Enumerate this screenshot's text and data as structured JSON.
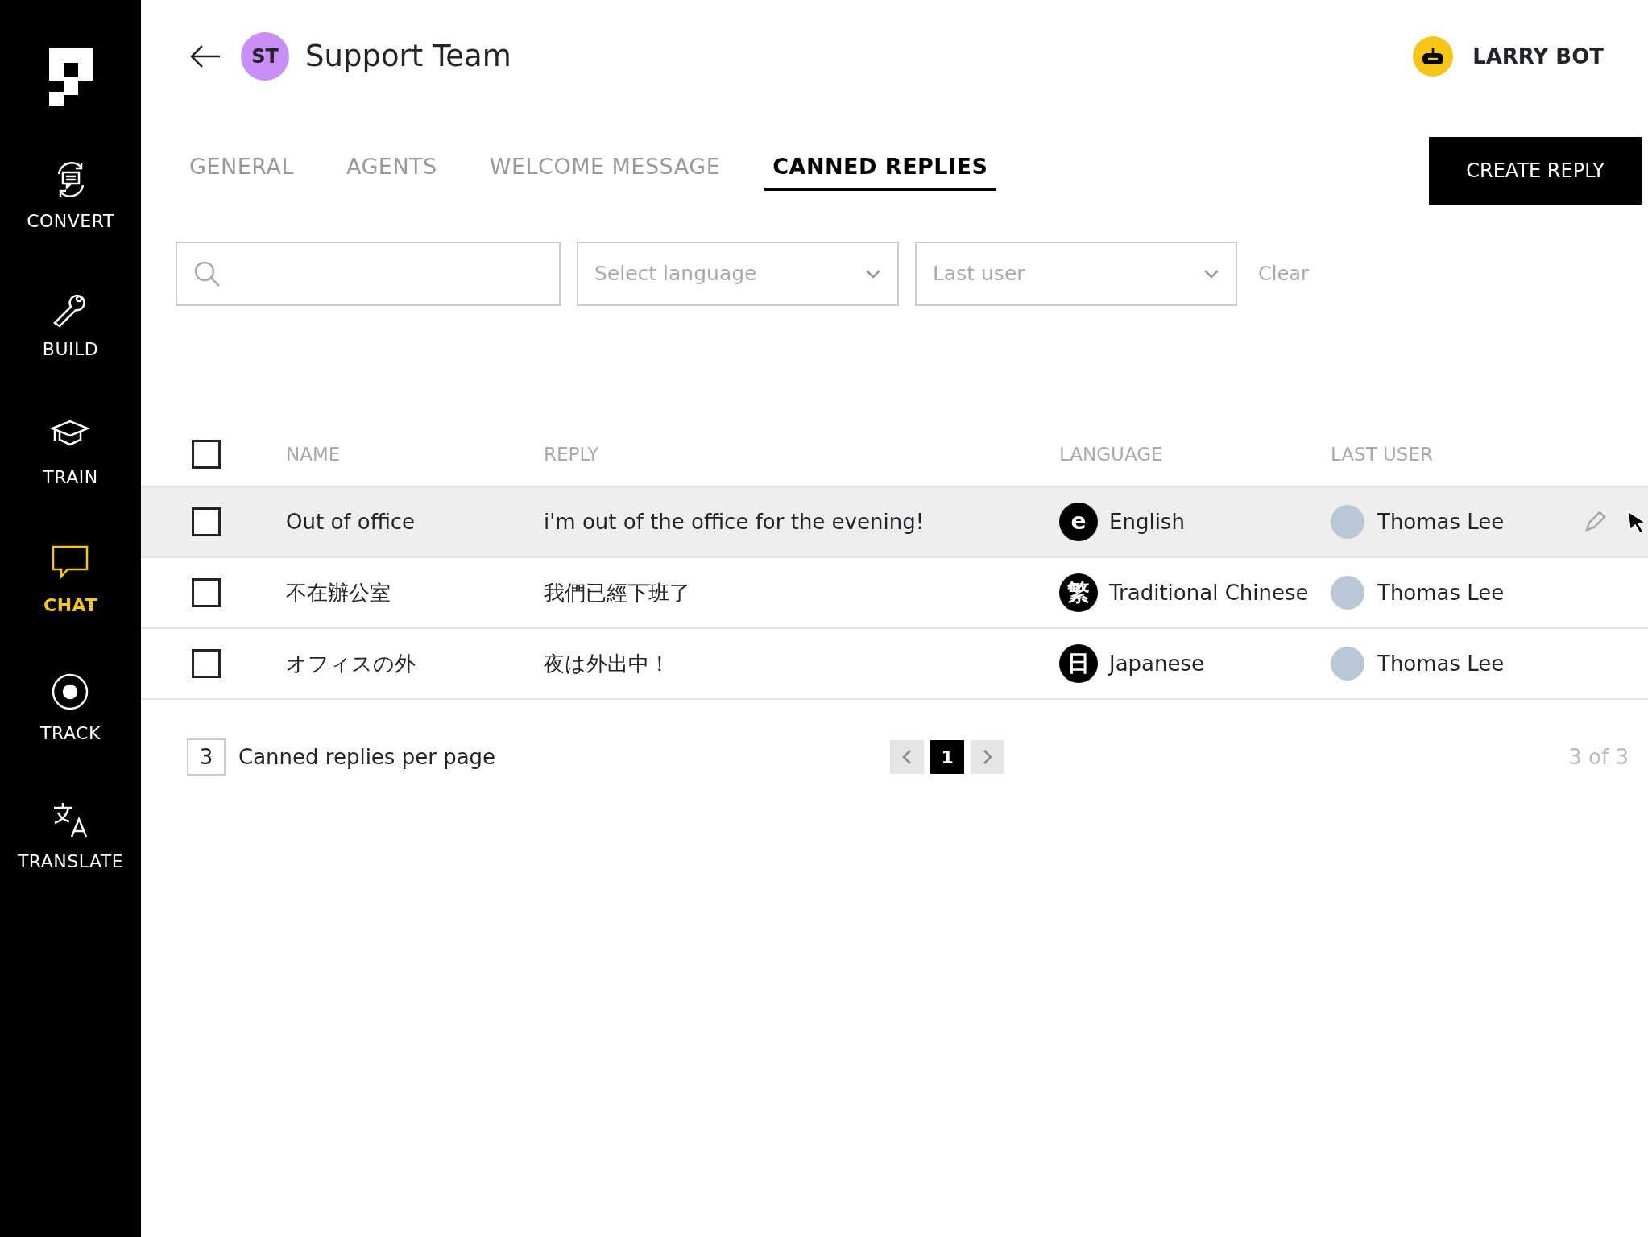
{
  "sidebar": {
    "items": [
      {
        "label": "CONVERT",
        "kind": "convert",
        "selected": false
      },
      {
        "label": "BUILD",
        "kind": "build",
        "selected": false
      },
      {
        "label": "TRAIN",
        "kind": "train",
        "selected": false
      },
      {
        "label": "CHAT",
        "kind": "chat",
        "selected": true
      },
      {
        "label": "TRACK",
        "kind": "track",
        "selected": false
      },
      {
        "label": "TRANSLATE",
        "kind": "translate",
        "selected": false
      }
    ]
  },
  "header": {
    "team_initials": "ST",
    "team_name": "Support Team",
    "bot_name": "LARRY BOT"
  },
  "tabs": [
    {
      "label": "GENERAL",
      "selected": false
    },
    {
      "label": "AGENTS",
      "selected": false
    },
    {
      "label": "WELCOME MESSAGE",
      "selected": false
    },
    {
      "label": "CANNED REPLIES",
      "selected": true
    }
  ],
  "create_button": "CREATE REPLY",
  "filters": {
    "language_placeholder": "Select language",
    "user_placeholder": "Last user",
    "clear": "Clear"
  },
  "table": {
    "columns": [
      "NAME",
      "REPLY",
      "LANGUAGE",
      "LAST USER"
    ],
    "select_all_checked": false,
    "rows": [
      {
        "name": "Out of office",
        "reply": "i'm out of the office for the evening!",
        "language_badge": "e",
        "language": "English",
        "last_user": "Thomas Lee",
        "checked": false,
        "hovered": true
      },
      {
        "name": "不在辦公室",
        "reply": "我們已經下班了",
        "language_badge": "繁",
        "language": "Traditional Chinese",
        "last_user": "Thomas Lee",
        "checked": false,
        "hovered": false
      },
      {
        "name": "オフィスの外",
        "reply": "夜は外出中！",
        "language_badge": "日",
        "language": "Japanese",
        "last_user": "Thomas Lee",
        "checked": false,
        "hovered": false
      }
    ]
  },
  "footer": {
    "per_page": "3",
    "per_page_label": "Canned replies per page",
    "pages": [
      {
        "label": "1",
        "selected": true
      }
    ],
    "count": "3 of 3"
  }
}
